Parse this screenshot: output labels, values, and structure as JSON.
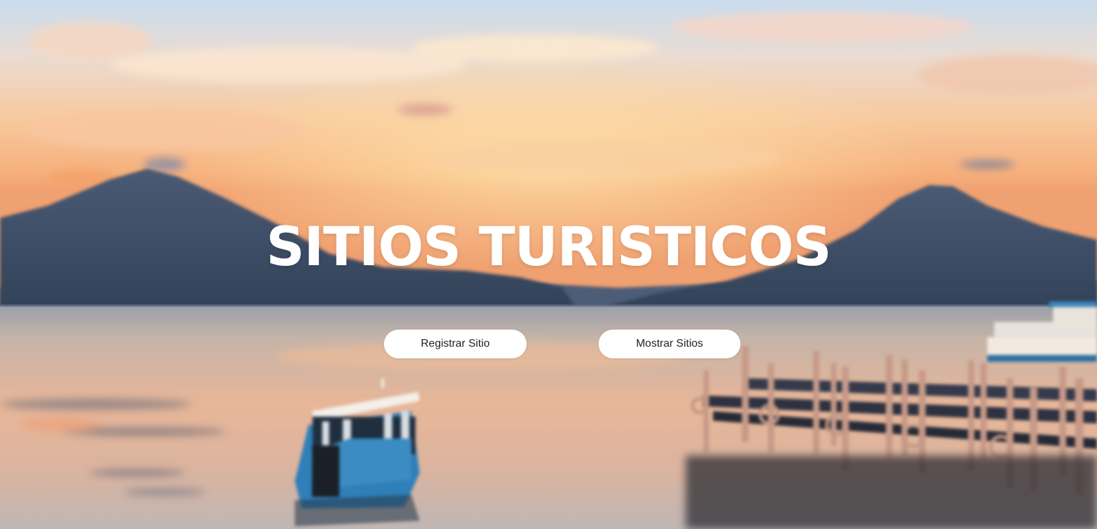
{
  "hero": {
    "title": "SITIOS TURISTICOS",
    "background": "lake-volcano-sunset-image"
  },
  "actions": {
    "register_label": "Registrar Sitio",
    "show_label": "Mostrar Sitios"
  },
  "colors": {
    "sky_top": "#cfe0ef",
    "sky_glow": "#f7c28d",
    "mountain": "#3c4d67",
    "water": "#c9b7ad",
    "button_bg": "#ffffff",
    "button_text": "#222222",
    "title_text": "#ffffff"
  }
}
